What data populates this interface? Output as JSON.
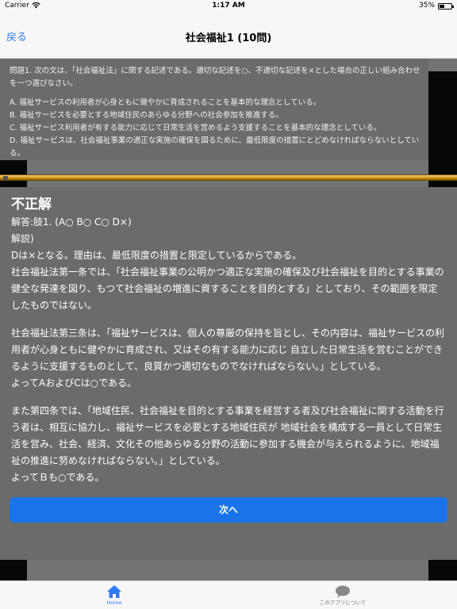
{
  "status_bar": {
    "carrier": "Carrier",
    "time": "1:17 AM",
    "battery": "35%"
  },
  "nav": {
    "back_label": "戻る",
    "title": "社会福祉1 (10問)"
  },
  "question": {
    "text": "問題1. 次の文は、「社会福祉法」に関する記述である。適切な記述を○、不適切な記述を×とした場合の正しい組み合わせを一つ選びなさい。",
    "options": [
      "A. 福祉サービスの利用者が心身ともに健やかに育成されることを基本的な理念としている。",
      "B. 福祉サービスを必要とする地域住民のあらゆる分野への社会参加を推進する。",
      "C. 福祉サービス利用者が有する能力に応じて日常生活を営めるよう支援することを基本的な理念としている。",
      "D. 福祉サービスは、社会福祉事業の適正な実施の確保を図るために、最低限度の措置にとどめなければならないとしている。"
    ]
  },
  "answer": {
    "result": "不正解",
    "answer_line": "解答:肢1. (A○ B○ C○ D×)",
    "explanation_label": "解説)",
    "paragraphs": [
      "Dは×となる。理由は、最低限度の措置と限定しているからである。",
      "社会福祉法第一条では、「社会福祉事業の公明かつ適正な実施の確保及び社会福祉を目的とする事業の健全な発達を図り、もつて社会福祉の増進に資することを目的とする」としており、その範囲を限定したものではない。",
      "社会福祉法第三条は、「福祉サービスは、個人の尊厳の保持を旨とし、その内容は、福祉サービスの利用者が心身ともに健やかに育成され、又はその有する能力に応じ 自立した日常生活を営むことができるように支援するものとして、良質かつ適切なものでなければならない。」としている。",
      "よってAおよびCは○である。",
      "また第四条では、「地域住民、社会福祉を目的とする事業を経営する者及び社会福祉に関する活動を行う者は、相互に協力し、福祉サービスを必要とする地域住民が 地域社会を構成する一員として日常生活を営み、社会、経済、文化その他あらゆる分野の活動に参加する機会が与えられるように、地域福祉の推進に努めなければならない。」としている。",
      "よってＢも○である。"
    ]
  },
  "next_button": "次へ",
  "tabs": {
    "home": "Home",
    "about": "このアプリについて"
  },
  "colors": {
    "accent": "#2f7bf6",
    "button": "#1a73e8",
    "panel": "#6b6b6b"
  }
}
